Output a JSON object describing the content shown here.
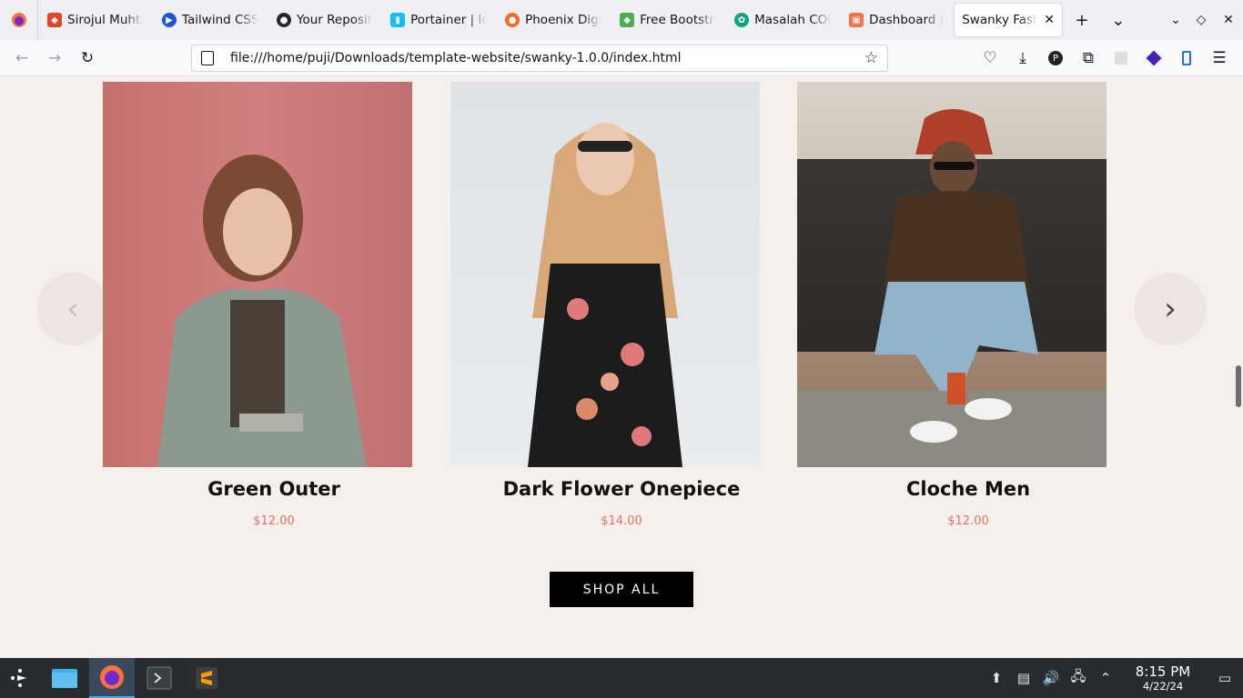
{
  "browser": {
    "tabs": [
      {
        "title": "Sirojul Muhta",
        "icon": "gitlab-icon",
        "color": "#e2432a"
      },
      {
        "title": "Tailwind CSS",
        "icon": "tailwind-icon",
        "color": "#1a56db"
      },
      {
        "title": "Your Reposit",
        "icon": "github-icon",
        "color": "#24292e"
      },
      {
        "title": "Portainer | lc",
        "icon": "portainer-icon",
        "color": "#13bef9"
      },
      {
        "title": "Phoenix Digi",
        "icon": "phoenix-icon",
        "color": "#f26b21"
      },
      {
        "title": "Free Bootstra",
        "icon": "bootstrap-icon",
        "color": "#4caf50"
      },
      {
        "title": "Masalah COR",
        "icon": "chatgpt-icon",
        "color": "#10a37f"
      },
      {
        "title": "Dashboard |",
        "icon": "dashboard-icon",
        "color": "#ff7043"
      }
    ],
    "active_tab": {
      "title": "Swanky Fashio",
      "close": "✕"
    },
    "new_tab": "+",
    "tab_list": "⌄",
    "url": "file:///home/puji/Downloads/template-website/swanky-1.0.0/index.html"
  },
  "page": {
    "products": [
      {
        "name": "Green Outer",
        "price": "$12.00"
      },
      {
        "name": "Dark Flower Onepiece",
        "price": "$14.00"
      },
      {
        "name": "Cloche Men",
        "price": "$12.00"
      }
    ],
    "prev_arrow": "‹",
    "next_arrow": "›",
    "shop_all": "SHOP ALL"
  },
  "taskbar": {
    "time": "8:15 PM",
    "date": "4/22/24"
  },
  "colors": {
    "page_bg": "#f6f0ed",
    "price": "#e0705f",
    "button_bg": "#000000"
  }
}
